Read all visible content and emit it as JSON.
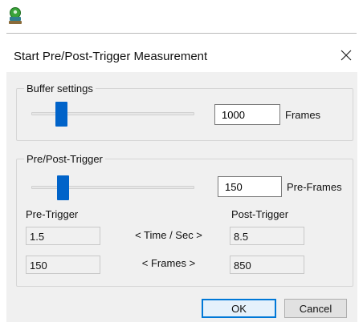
{
  "window": {
    "app_icon": "green-person-icon",
    "dialog_title": "Start Pre/Post-Trigger Measurement",
    "close_icon": "close-icon"
  },
  "buffer_settings": {
    "legend": "Buffer settings",
    "slider_fraction": 0.16,
    "frames_value": "1000",
    "frames_unit": "Frames"
  },
  "prepost_trigger": {
    "legend": "Pre/Post-Trigger",
    "slider_fraction": 0.17,
    "pre_frames_value": "150",
    "pre_frames_unit": "Pre-Frames",
    "pre_trigger_label": "Pre-Trigger",
    "post_trigger_label": "Post-Trigger",
    "time_label": "< Time / Sec >",
    "frames_label": "< Frames >",
    "pre_time_value": "1.5",
    "post_time_value": "8.5",
    "pre_frames_count": "150",
    "post_frames_count": "850"
  },
  "buttons": {
    "ok_label": "OK",
    "cancel_label": "Cancel"
  },
  "colors": {
    "accent": "#0063c9",
    "default_button_border": "#0078d7",
    "dialog_background": "#f0f0f0"
  }
}
